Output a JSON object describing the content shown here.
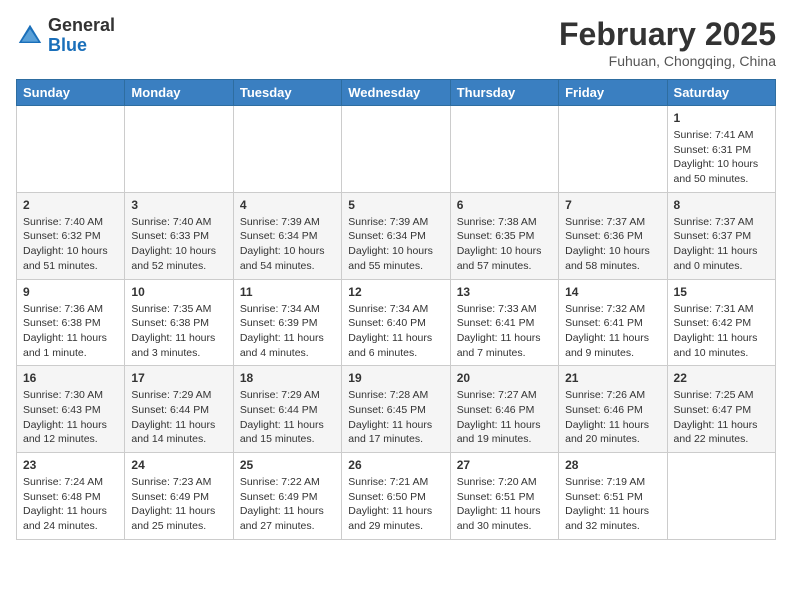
{
  "header": {
    "logo_general": "General",
    "logo_blue": "Blue",
    "month_year": "February 2025",
    "location": "Fuhuan, Chongqing, China"
  },
  "days_of_week": [
    "Sunday",
    "Monday",
    "Tuesday",
    "Wednesday",
    "Thursday",
    "Friday",
    "Saturday"
  ],
  "weeks": [
    [
      {
        "day": "",
        "info": ""
      },
      {
        "day": "",
        "info": ""
      },
      {
        "day": "",
        "info": ""
      },
      {
        "day": "",
        "info": ""
      },
      {
        "day": "",
        "info": ""
      },
      {
        "day": "",
        "info": ""
      },
      {
        "day": "1",
        "info": "Sunrise: 7:41 AM\nSunset: 6:31 PM\nDaylight: 10 hours and 50 minutes."
      }
    ],
    [
      {
        "day": "2",
        "info": "Sunrise: 7:40 AM\nSunset: 6:32 PM\nDaylight: 10 hours and 51 minutes."
      },
      {
        "day": "3",
        "info": "Sunrise: 7:40 AM\nSunset: 6:33 PM\nDaylight: 10 hours and 52 minutes."
      },
      {
        "day": "4",
        "info": "Sunrise: 7:39 AM\nSunset: 6:34 PM\nDaylight: 10 hours and 54 minutes."
      },
      {
        "day": "5",
        "info": "Sunrise: 7:39 AM\nSunset: 6:34 PM\nDaylight: 10 hours and 55 minutes."
      },
      {
        "day": "6",
        "info": "Sunrise: 7:38 AM\nSunset: 6:35 PM\nDaylight: 10 hours and 57 minutes."
      },
      {
        "day": "7",
        "info": "Sunrise: 7:37 AM\nSunset: 6:36 PM\nDaylight: 10 hours and 58 minutes."
      },
      {
        "day": "8",
        "info": "Sunrise: 7:37 AM\nSunset: 6:37 PM\nDaylight: 11 hours and 0 minutes."
      }
    ],
    [
      {
        "day": "9",
        "info": "Sunrise: 7:36 AM\nSunset: 6:38 PM\nDaylight: 11 hours and 1 minute."
      },
      {
        "day": "10",
        "info": "Sunrise: 7:35 AM\nSunset: 6:38 PM\nDaylight: 11 hours and 3 minutes."
      },
      {
        "day": "11",
        "info": "Sunrise: 7:34 AM\nSunset: 6:39 PM\nDaylight: 11 hours and 4 minutes."
      },
      {
        "day": "12",
        "info": "Sunrise: 7:34 AM\nSunset: 6:40 PM\nDaylight: 11 hours and 6 minutes."
      },
      {
        "day": "13",
        "info": "Sunrise: 7:33 AM\nSunset: 6:41 PM\nDaylight: 11 hours and 7 minutes."
      },
      {
        "day": "14",
        "info": "Sunrise: 7:32 AM\nSunset: 6:41 PM\nDaylight: 11 hours and 9 minutes."
      },
      {
        "day": "15",
        "info": "Sunrise: 7:31 AM\nSunset: 6:42 PM\nDaylight: 11 hours and 10 minutes."
      }
    ],
    [
      {
        "day": "16",
        "info": "Sunrise: 7:30 AM\nSunset: 6:43 PM\nDaylight: 11 hours and 12 minutes."
      },
      {
        "day": "17",
        "info": "Sunrise: 7:29 AM\nSunset: 6:44 PM\nDaylight: 11 hours and 14 minutes."
      },
      {
        "day": "18",
        "info": "Sunrise: 7:29 AM\nSunset: 6:44 PM\nDaylight: 11 hours and 15 minutes."
      },
      {
        "day": "19",
        "info": "Sunrise: 7:28 AM\nSunset: 6:45 PM\nDaylight: 11 hours and 17 minutes."
      },
      {
        "day": "20",
        "info": "Sunrise: 7:27 AM\nSunset: 6:46 PM\nDaylight: 11 hours and 19 minutes."
      },
      {
        "day": "21",
        "info": "Sunrise: 7:26 AM\nSunset: 6:46 PM\nDaylight: 11 hours and 20 minutes."
      },
      {
        "day": "22",
        "info": "Sunrise: 7:25 AM\nSunset: 6:47 PM\nDaylight: 11 hours and 22 minutes."
      }
    ],
    [
      {
        "day": "23",
        "info": "Sunrise: 7:24 AM\nSunset: 6:48 PM\nDaylight: 11 hours and 24 minutes."
      },
      {
        "day": "24",
        "info": "Sunrise: 7:23 AM\nSunset: 6:49 PM\nDaylight: 11 hours and 25 minutes."
      },
      {
        "day": "25",
        "info": "Sunrise: 7:22 AM\nSunset: 6:49 PM\nDaylight: 11 hours and 27 minutes."
      },
      {
        "day": "26",
        "info": "Sunrise: 7:21 AM\nSunset: 6:50 PM\nDaylight: 11 hours and 29 minutes."
      },
      {
        "day": "27",
        "info": "Sunrise: 7:20 AM\nSunset: 6:51 PM\nDaylight: 11 hours and 30 minutes."
      },
      {
        "day": "28",
        "info": "Sunrise: 7:19 AM\nSunset: 6:51 PM\nDaylight: 11 hours and 32 minutes."
      },
      {
        "day": "",
        "info": ""
      }
    ]
  ]
}
